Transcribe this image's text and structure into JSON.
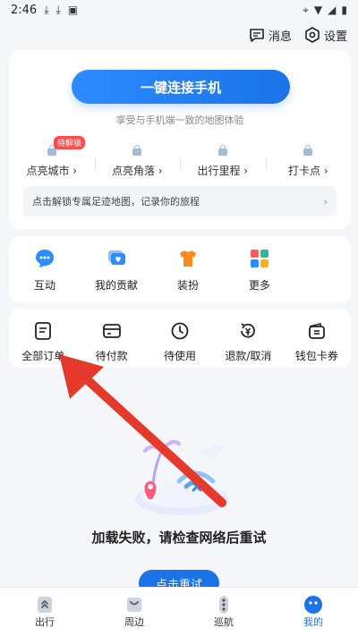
{
  "status_bar": {
    "time": "2:46"
  },
  "top": {
    "messages": "消息",
    "settings": "设置"
  },
  "connect": {
    "button": "一键连接手机",
    "subtitle": "享受与手机端一致的地图体验"
  },
  "unlock": {
    "badge": "待解锁",
    "items": [
      {
        "label": "点亮城市 ›"
      },
      {
        "label": "点亮角落 ›"
      },
      {
        "label": "出行里程 ›"
      },
      {
        "label": "打卡点 ›"
      }
    ],
    "promo": "点击解锁专属足迹地图，记录你的旅程",
    "promo_chevron": "›"
  },
  "quick": {
    "items": [
      {
        "label": "互动",
        "icon": "chat-icon",
        "color": "#2d8cff"
      },
      {
        "label": "我的贡献",
        "icon": "heart-chat-icon",
        "color": "#2d8cff"
      },
      {
        "label": "装扮",
        "icon": "tshirt-icon",
        "color": "#ff8a1f"
      },
      {
        "label": "更多",
        "icon": "grid-icon",
        "color": "#2db7a0"
      }
    ]
  },
  "orders": {
    "items": [
      {
        "label": "全部订单",
        "icon": "document-icon"
      },
      {
        "label": "待付款",
        "icon": "card-icon"
      },
      {
        "label": "待使用",
        "icon": "clock-icon"
      },
      {
        "label": "退款/取消",
        "icon": "refund-icon"
      },
      {
        "label": "钱包卡券",
        "icon": "wallet-icon"
      }
    ]
  },
  "error": {
    "text": "加载失败，请检查网络后重试",
    "retry": "点击重试"
  },
  "nav": {
    "items": [
      {
        "label": "出行",
        "icon": "route-icon"
      },
      {
        "label": "周边",
        "icon": "bag-icon"
      },
      {
        "label": "巡航",
        "icon": "traffic-light-icon"
      },
      {
        "label": "我的",
        "icon": "smile-icon"
      }
    ]
  },
  "colors": {
    "accent": "#1a73e8",
    "badge": "#ff4d4f",
    "arrow": "#e5392b"
  }
}
